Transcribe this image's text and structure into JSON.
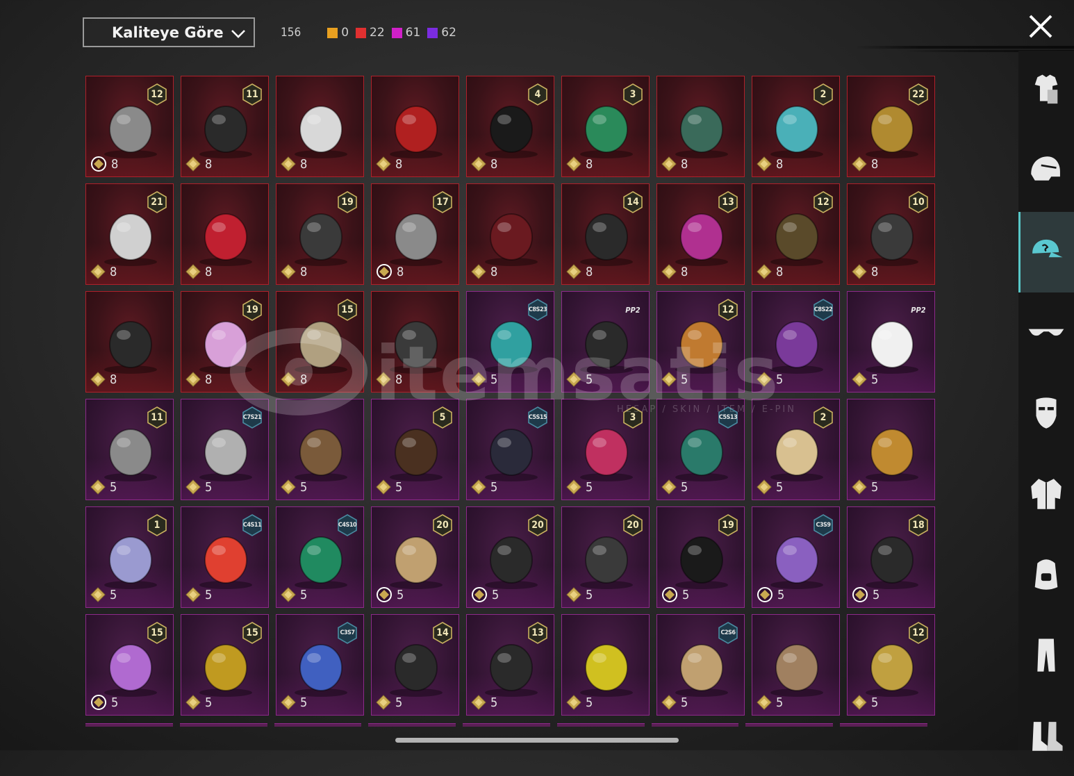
{
  "header": {
    "sort_label": "Kaliteye Göre",
    "total_count": "156",
    "quality_counts": [
      {
        "color": "#e8a020",
        "count": "0"
      },
      {
        "color": "#e03030",
        "count": "22"
      },
      {
        "color": "#d020c8",
        "count": "61"
      },
      {
        "color": "#7b2ce0",
        "count": "62"
      }
    ]
  },
  "sidebar": {
    "categories": [
      {
        "name": "outfit",
        "icon": "outfit-icon"
      },
      {
        "name": "helmet",
        "icon": "helmet-icon"
      },
      {
        "name": "hat",
        "icon": "cap-icon",
        "active": true
      },
      {
        "name": "glasses",
        "icon": "glasses-icon"
      },
      {
        "name": "mask",
        "icon": "mask-icon"
      },
      {
        "name": "jacket",
        "icon": "jacket-icon"
      },
      {
        "name": "backpack",
        "icon": "backpack-icon"
      },
      {
        "name": "pants",
        "icon": "pants-icon"
      },
      {
        "name": "shoes",
        "icon": "shoes-icon"
      }
    ]
  },
  "items": [
    {
      "quality": "red",
      "badge": "12",
      "cost": "8",
      "currency": "ring"
    },
    {
      "quality": "red",
      "badge": "11",
      "cost": "8",
      "currency": "gem"
    },
    {
      "quality": "red",
      "badge": "",
      "cost": "8",
      "currency": "gem"
    },
    {
      "quality": "red",
      "badge": "",
      "cost": "8",
      "currency": "gem"
    },
    {
      "quality": "red",
      "badge": "4",
      "cost": "8",
      "currency": "gem"
    },
    {
      "quality": "red",
      "badge": "3",
      "cost": "8",
      "currency": "gem"
    },
    {
      "quality": "red",
      "badge": "",
      "cost": "8",
      "currency": "gem"
    },
    {
      "quality": "red",
      "badge": "2",
      "cost": "8",
      "currency": "gem"
    },
    {
      "quality": "red",
      "badge": "22",
      "cost": "8",
      "currency": "gem"
    },
    {
      "quality": "red",
      "badge": "21",
      "cost": "8",
      "currency": "gem"
    },
    {
      "quality": "red",
      "badge": "",
      "cost": "8",
      "currency": "gem"
    },
    {
      "quality": "red",
      "badge": "19",
      "cost": "8",
      "currency": "gem"
    },
    {
      "quality": "red",
      "badge": "17",
      "cost": "8",
      "currency": "ring"
    },
    {
      "quality": "red",
      "badge": "",
      "cost": "8",
      "currency": "gem"
    },
    {
      "quality": "red",
      "badge": "14",
      "cost": "8",
      "currency": "gem"
    },
    {
      "quality": "red",
      "badge": "13",
      "cost": "8",
      "currency": "gem"
    },
    {
      "quality": "red",
      "badge": "12",
      "cost": "8",
      "currency": "gem"
    },
    {
      "quality": "red",
      "badge": "10",
      "cost": "8",
      "currency": "gem"
    },
    {
      "quality": "red",
      "badge": "",
      "cost": "8",
      "currency": "gem"
    },
    {
      "quality": "red",
      "badge": "19",
      "cost": "8",
      "currency": "gem"
    },
    {
      "quality": "red",
      "badge": "15",
      "cost": "8",
      "currency": "gem"
    },
    {
      "quality": "red",
      "badge": "",
      "cost": "8",
      "currency": "gem"
    },
    {
      "quality": "purple",
      "badge": "C8S23",
      "cost": "5",
      "currency": "gem"
    },
    {
      "quality": "purple",
      "badge": "PP2",
      "cost": "5",
      "currency": "gem"
    },
    {
      "quality": "purple",
      "badge": "12",
      "cost": "5",
      "currency": "gem"
    },
    {
      "quality": "purple",
      "badge": "C8S22",
      "cost": "5",
      "currency": "gem"
    },
    {
      "quality": "purple",
      "badge": "PP2",
      "cost": "5",
      "currency": "gem"
    },
    {
      "quality": "purple",
      "badge": "11",
      "cost": "5",
      "currency": "gem"
    },
    {
      "quality": "purple",
      "badge": "C7S21",
      "cost": "5",
      "currency": "gem"
    },
    {
      "quality": "purple",
      "badge": "",
      "cost": "5",
      "currency": "gem"
    },
    {
      "quality": "purple",
      "badge": "5",
      "cost": "5",
      "currency": "gem"
    },
    {
      "quality": "purple",
      "badge": "C5S15",
      "cost": "5",
      "currency": "gem"
    },
    {
      "quality": "purple",
      "badge": "3",
      "cost": "5",
      "currency": "gem"
    },
    {
      "quality": "purple",
      "badge": "C5S13",
      "cost": "5",
      "currency": "gem"
    },
    {
      "quality": "purple",
      "badge": "2",
      "cost": "5",
      "currency": "gem"
    },
    {
      "quality": "purple",
      "badge": "",
      "cost": "5",
      "currency": "gem"
    },
    {
      "quality": "purple",
      "badge": "1",
      "cost": "5",
      "currency": "gem"
    },
    {
      "quality": "purple",
      "badge": "C4S11",
      "cost": "5",
      "currency": "gem"
    },
    {
      "quality": "purple",
      "badge": "C4S10",
      "cost": "5",
      "currency": "gem"
    },
    {
      "quality": "purple",
      "badge": "20",
      "cost": "5",
      "currency": "ring"
    },
    {
      "quality": "purple",
      "badge": "20",
      "cost": "5",
      "currency": "ring"
    },
    {
      "quality": "purple",
      "badge": "20",
      "cost": "5",
      "currency": "gem"
    },
    {
      "quality": "purple",
      "badge": "19",
      "cost": "5",
      "currency": "ring"
    },
    {
      "quality": "purple",
      "badge": "C3S9",
      "cost": "5",
      "currency": "ring"
    },
    {
      "quality": "purple",
      "badge": "18",
      "cost": "5",
      "currency": "ring"
    },
    {
      "quality": "purple",
      "badge": "15",
      "cost": "5",
      "currency": "ring"
    },
    {
      "quality": "purple",
      "badge": "15",
      "cost": "5",
      "currency": "gem"
    },
    {
      "quality": "purple",
      "badge": "C3S7",
      "cost": "5",
      "currency": "gem"
    },
    {
      "quality": "purple",
      "badge": "14",
      "cost": "5",
      "currency": "gem"
    },
    {
      "quality": "purple",
      "badge": "13",
      "cost": "5",
      "currency": "gem"
    },
    {
      "quality": "purple",
      "badge": "",
      "cost": "5",
      "currency": "gem"
    },
    {
      "quality": "purple",
      "badge": "C2S6",
      "cost": "5",
      "currency": "gem"
    },
    {
      "quality": "purple",
      "badge": "",
      "cost": "5",
      "currency": "gem"
    },
    {
      "quality": "purple",
      "badge": "12",
      "cost": "5",
      "currency": "gem"
    }
  ],
  "watermark": {
    "brand": "itemsatis",
    "tagline": "HESAP / SKIN / ITEM / E-PIN"
  }
}
